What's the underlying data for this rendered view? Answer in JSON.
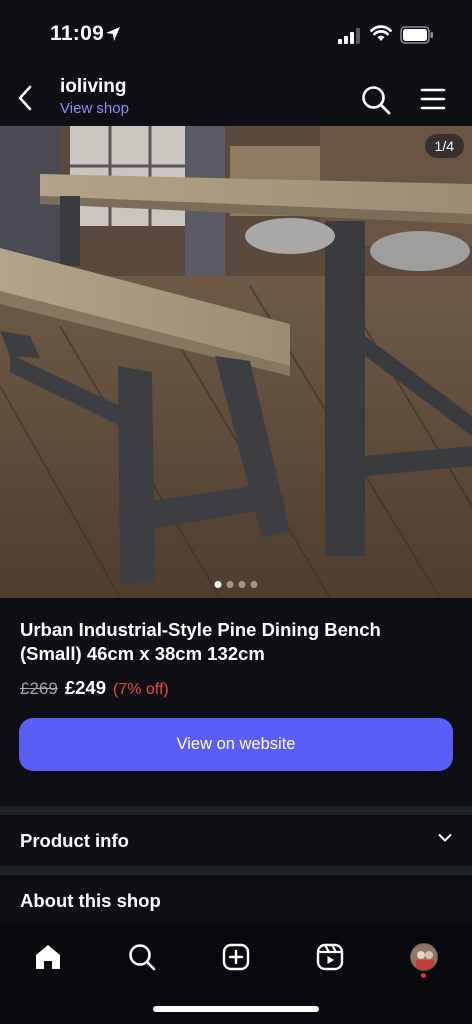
{
  "status_bar": {
    "time": "11:09",
    "icons": [
      "location-arrow-icon",
      "cellular-signal-icon",
      "wifi-icon",
      "battery-icon"
    ]
  },
  "header": {
    "shop_name": "ioliving",
    "view_shop_label": "View shop",
    "icons": [
      "back-arrow-icon",
      "search-icon",
      "hamburger-menu-icon"
    ]
  },
  "image": {
    "counter": "1/4",
    "dots": 4,
    "active_dot": 0
  },
  "product": {
    "title": "Urban Industrial-Style Pine Dining Bench (Small) 46cm x 38cm 132cm",
    "old_price": "£269",
    "price": "£249",
    "discount": "(7% off)",
    "cta_label": "View on website"
  },
  "sections": {
    "product_info": "Product info",
    "about_shop": "About this shop"
  },
  "tab_bar": {
    "tabs": [
      "home-icon",
      "search-icon",
      "create-post-icon",
      "reels-icon",
      "profile-avatar"
    ]
  },
  "colors": {
    "background": "#0e0f14",
    "accent_button": "#5b5ef6",
    "link": "#8a8cf5",
    "discount": "#ee4444",
    "divider": "#20222a"
  }
}
